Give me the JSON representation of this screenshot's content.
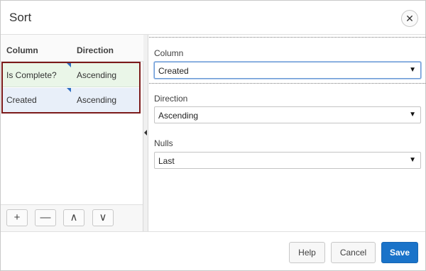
{
  "dialog": {
    "title": "Sort",
    "close_icon": "close-icon"
  },
  "list": {
    "headers": {
      "column": "Column",
      "direction": "Direction"
    },
    "rows": [
      {
        "column": "Is Complete?",
        "direction": "Ascending"
      },
      {
        "column": "Created",
        "direction": "Ascending"
      }
    ]
  },
  "toolbar": {
    "add": "+",
    "remove": "—",
    "up": "∧",
    "down": "∨"
  },
  "form": {
    "column": {
      "label": "Column",
      "value": "Created"
    },
    "direction": {
      "label": "Direction",
      "value": "Ascending"
    },
    "nulls": {
      "label": "Nulls",
      "value": "Last"
    }
  },
  "footer": {
    "help": "Help",
    "cancel": "Cancel",
    "save": "Save"
  },
  "colors": {
    "accent": "#1a73c9",
    "selection_border": "#7c1a1a",
    "row_green": "#eaf6e8",
    "row_blue": "#e8eff9"
  }
}
